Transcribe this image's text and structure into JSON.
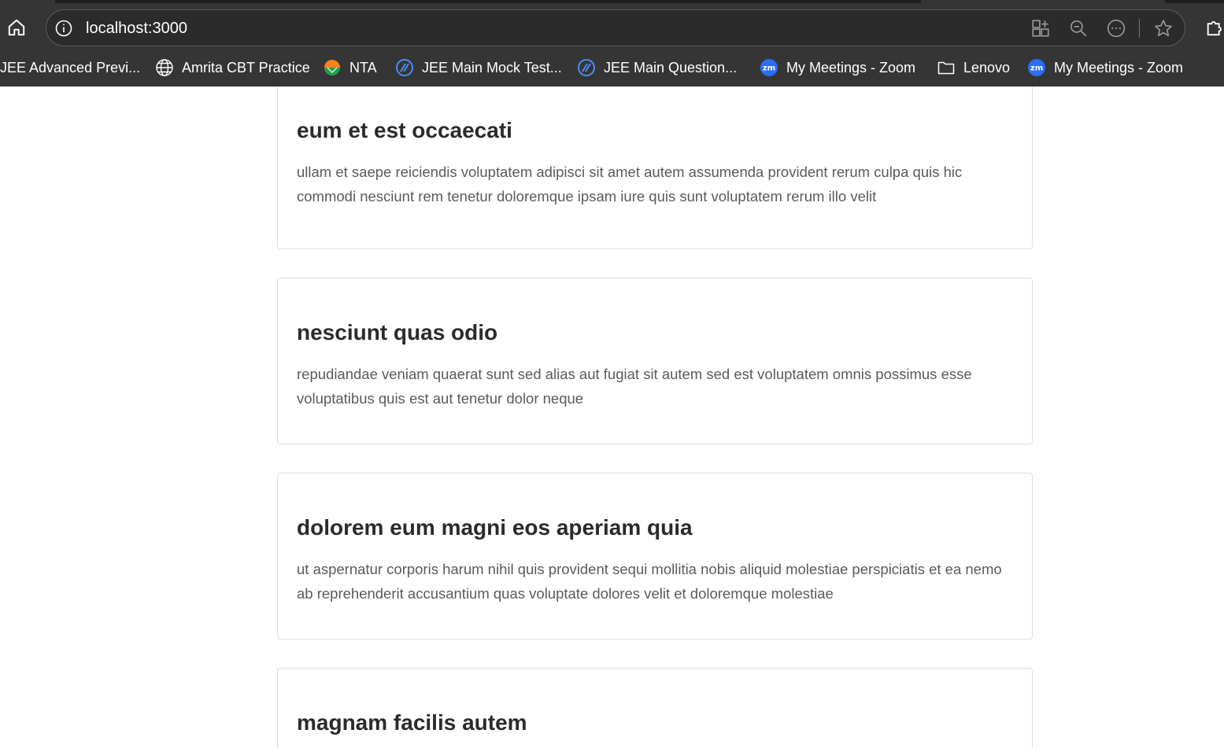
{
  "browser": {
    "url": "localhost:3000",
    "bookmarks": [
      {
        "label": "JEE Advanced Previ...",
        "icon": "none"
      },
      {
        "label": "Amrita CBT Practice",
        "icon": "globe-icon"
      },
      {
        "label": "NTA",
        "icon": "nta-logo-icon"
      },
      {
        "label": "JEE Main Mock Test...",
        "icon": "testbook-logo-icon"
      },
      {
        "label": "JEE Main Question...",
        "icon": "testbook-logo-icon"
      },
      {
        "label": "My Meetings - Zoom",
        "icon": "zoom-logo-icon"
      },
      {
        "label": "Lenovo",
        "icon": "folder-icon"
      },
      {
        "label": "My Meetings - Zoom",
        "icon": "zoom-logo-icon"
      }
    ],
    "zoom_badge": "zm"
  },
  "posts": [
    {
      "title": "eum et est occaecati",
      "body": "ullam et saepe reiciendis voluptatem adipisci sit amet autem assumenda provident rerum culpa quis hic commodi nesciunt rem tenetur doloremque ipsam iure quis sunt voluptatem rerum illo velit"
    },
    {
      "title": "nesciunt quas odio",
      "body": "repudiandae veniam quaerat sunt sed alias aut fugiat sit autem sed est voluptatem omnis possimus esse voluptatibus quis est aut tenetur dolor neque"
    },
    {
      "title": "dolorem eum magni eos aperiam quia",
      "body": "ut aspernatur corporis harum nihil quis provident sequi mollitia nobis aliquid molestiae perspiciatis et ea nemo ab reprehenderit accusantium quas voluptate dolores velit et doloremque molestiae"
    },
    {
      "title": "magnam facilis autem",
      "body": ""
    }
  ],
  "colors": {
    "chrome_bg": "#353535",
    "page_bg": "#ffffff",
    "title_text": "#2b2b2b",
    "body_text": "#5a5a5a",
    "card_border": "#dedede"
  }
}
